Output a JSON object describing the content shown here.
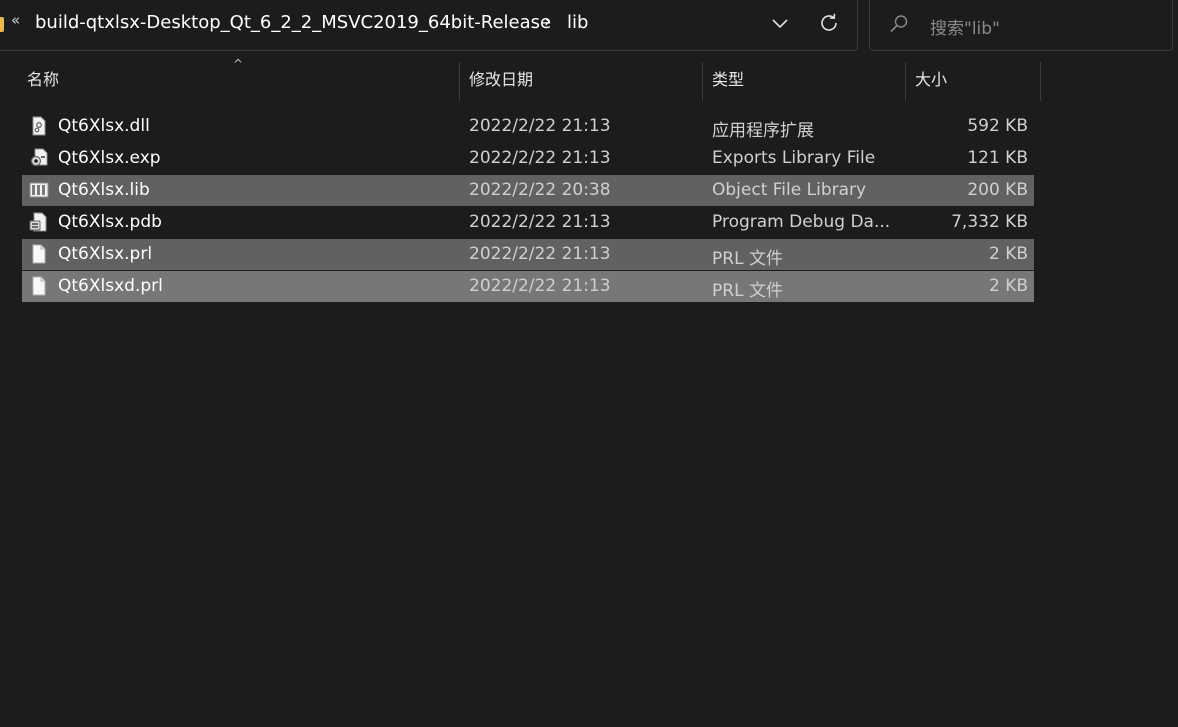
{
  "address": {
    "overflow_chevron": "«",
    "path": [
      "build-qtxlsx-Desktop_Qt_6_2_2_MSVC2019_64bit-Release",
      "lib"
    ],
    "separator": "›",
    "dropdown_icon": "chevron-down-icon",
    "refresh_icon": "refresh-icon"
  },
  "search": {
    "placeholder": "搜索\"lib\"",
    "icon": "search-icon"
  },
  "columns": {
    "name": "名称",
    "date": "修改日期",
    "type": "类型",
    "size": "大小",
    "sort_indicator": "^"
  },
  "files": [
    {
      "name": "Qt6Xlsx.dll",
      "date": "2022/2/22 21:13",
      "type": "应用程序扩展",
      "size": "592 KB",
      "icon": "dll-file-icon",
      "selected": false
    },
    {
      "name": "Qt6Xlsx.exp",
      "date": "2022/2/22 21:13",
      "type": "Exports Library File",
      "size": "121 KB",
      "icon": "exp-file-icon",
      "selected": false
    },
    {
      "name": "Qt6Xlsx.lib",
      "date": "2022/2/22 20:38",
      "type": "Object File Library",
      "size": "200 KB",
      "icon": "lib-file-icon",
      "selected": true
    },
    {
      "name": "Qt6Xlsx.pdb",
      "date": "2022/2/22 21:13",
      "type": "Program Debug Da...",
      "size": "7,332 KB",
      "icon": "pdb-file-icon",
      "selected": false
    },
    {
      "name": "Qt6Xlsx.prl",
      "date": "2022/2/22 21:13",
      "type": "PRL 文件",
      "size": "2 KB",
      "icon": "generic-file-icon",
      "selected": true
    },
    {
      "name": "Qt6Xlsxd.prl",
      "date": "2022/2/22 21:13",
      "type": "PRL 文件",
      "size": "2 KB",
      "icon": "generic-file-icon",
      "selected": true
    }
  ],
  "colors": {
    "background": "#1c1c1c",
    "selection": "#616161",
    "hover_selection": "#777777",
    "folder_accent": "#e8b84a"
  }
}
